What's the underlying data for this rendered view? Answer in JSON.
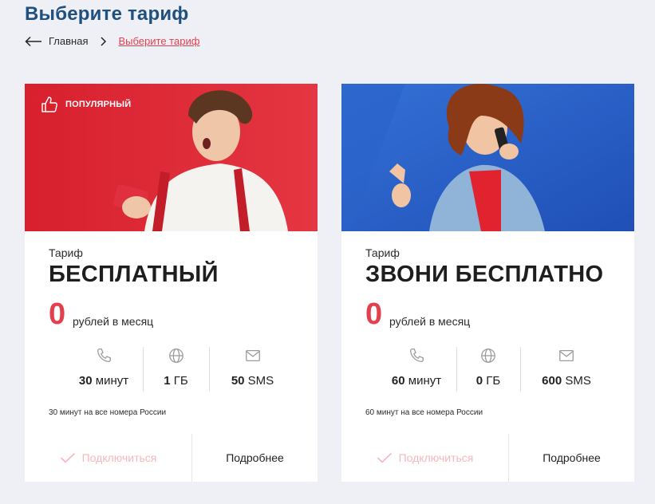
{
  "page": {
    "title": "Выберите тариф",
    "breadcrumb": {
      "home": "Главная",
      "current": "Выберите тариф"
    }
  },
  "colors": {
    "accent": "#e3404e",
    "title": "#20507e",
    "background": "#eef0f5"
  },
  "cards": [
    {
      "badge": "ПОПУЛЯРНЫЙ",
      "badge_icon": "thumbs-up-icon",
      "hero_color": "#e02a35",
      "tariff_label": "Тариф",
      "name": "БЕСПЛАТНЫЙ",
      "price": "0",
      "price_unit": "рублей в месяц",
      "features": [
        {
          "icon": "phone-icon",
          "value": "30",
          "unit": "минут"
        },
        {
          "icon": "globe-icon",
          "value": "1",
          "unit": "ГБ"
        },
        {
          "icon": "mail-icon",
          "value": "50",
          "unit": "SMS"
        }
      ],
      "note": "30 минут на все номера России",
      "connect_label": "Подключиться",
      "more_label": "Подробнее"
    },
    {
      "badge": "",
      "hero_color": "#2a5fc9",
      "tariff_label": "Тариф",
      "name": "ЗВОНИ БЕСПЛАТНО",
      "price": "0",
      "price_unit": "рублей в месяц",
      "features": [
        {
          "icon": "phone-icon",
          "value": "60",
          "unit": "минут"
        },
        {
          "icon": "globe-icon",
          "value": "0",
          "unit": "ГБ"
        },
        {
          "icon": "mail-icon",
          "value": "600",
          "unit": "SMS"
        }
      ],
      "note": "60 минут на все номера России",
      "connect_label": "Подключиться",
      "more_label": "Подробнее"
    }
  ]
}
